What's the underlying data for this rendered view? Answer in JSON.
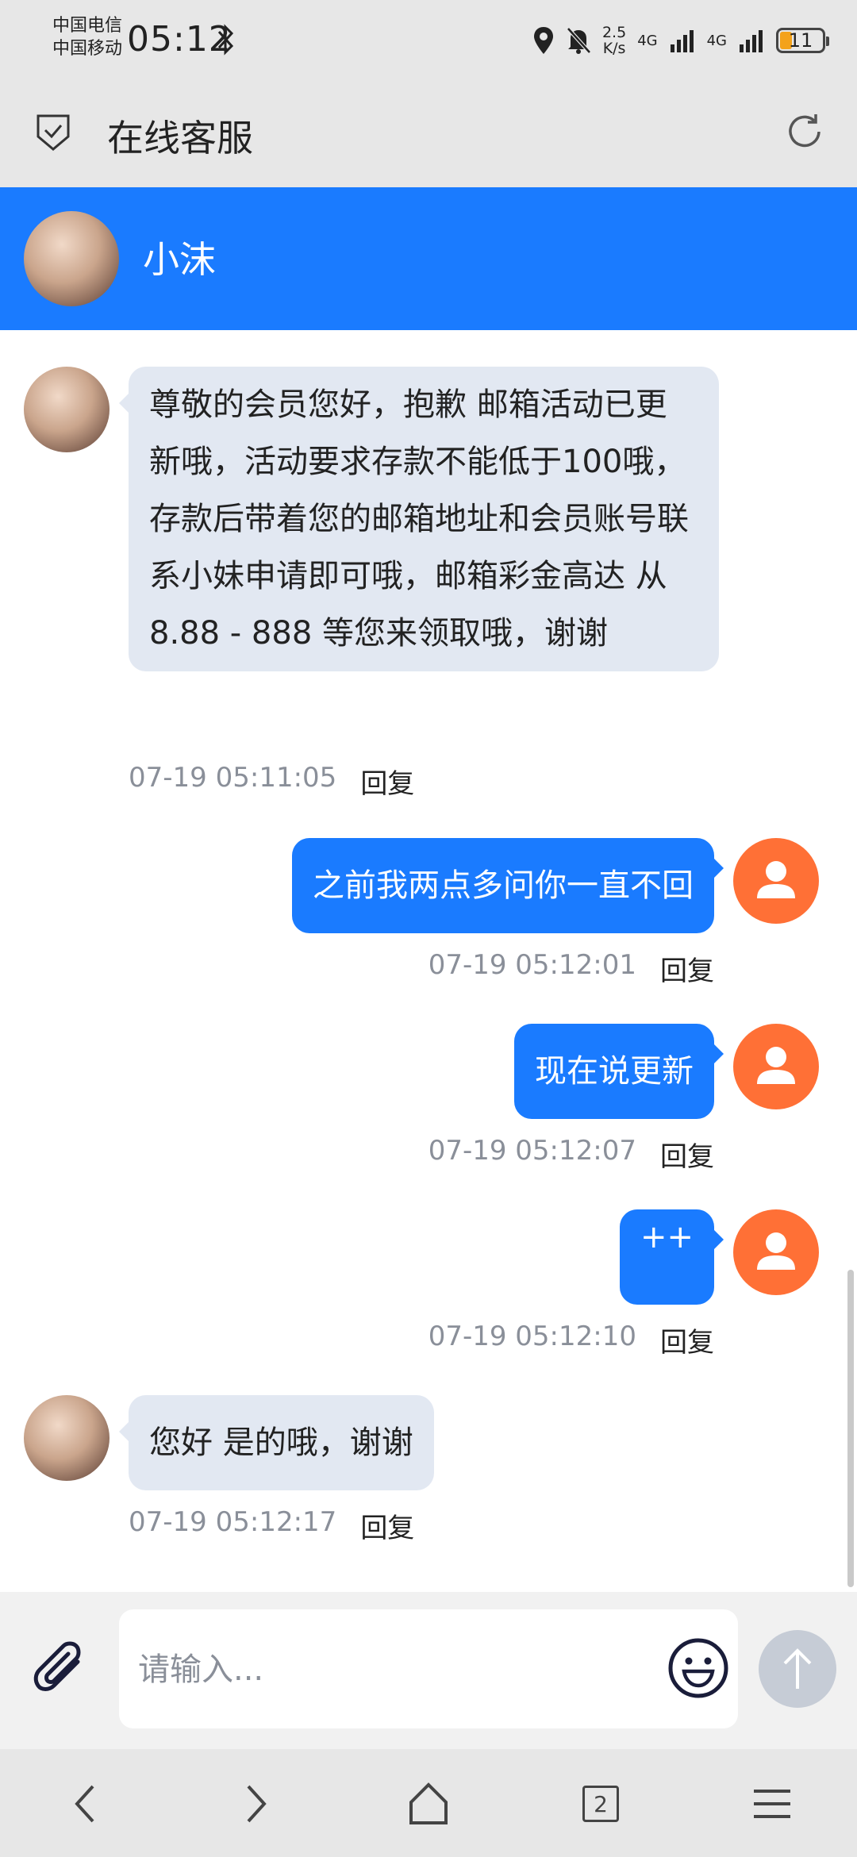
{
  "status_bar": {
    "carrier_1": "中国电信",
    "carrier_2": "中国移动",
    "time": "05:12",
    "speed_value": "2.5",
    "speed_unit": "K/s",
    "net_1": "4G",
    "net_2": "4G",
    "battery": "11",
    "battery_fraction": 0.11
  },
  "app_bar": {
    "title": "在线客服"
  },
  "agent": {
    "name": "小沫"
  },
  "messages": [
    {
      "side": "in",
      "text": "尊敬的会员您好，抱歉 邮箱活动已更新哦，活动要求存款不能低于100哦，存款后带着您的邮箱地址和会员账号联系小妹申请即可哦，邮箱彩金高达 从8.88 - 888 等您来领取哦，谢谢",
      "time": "07-19 05:11:05",
      "reply": "回复"
    },
    {
      "side": "out",
      "text": "之前我两点多问你一直不回",
      "time": "07-19 05:12:01",
      "reply": "回复"
    },
    {
      "side": "out",
      "text": "现在说更新",
      "time": "07-19 05:12:07",
      "reply": "回复"
    },
    {
      "side": "out",
      "text": "++",
      "time": "07-19 05:12:10",
      "reply": "回复"
    },
    {
      "side": "in",
      "text": "您好 是的哦，谢谢",
      "time": "07-19 05:12:17",
      "reply": "回复"
    }
  ],
  "input": {
    "placeholder": "请输入...",
    "value": ""
  },
  "nav": {
    "tab_count": "2"
  },
  "colors": {
    "accent": "#1a7bff",
    "user_avatar": "#ff7036",
    "incoming_bubble": "#e2e8f2"
  }
}
